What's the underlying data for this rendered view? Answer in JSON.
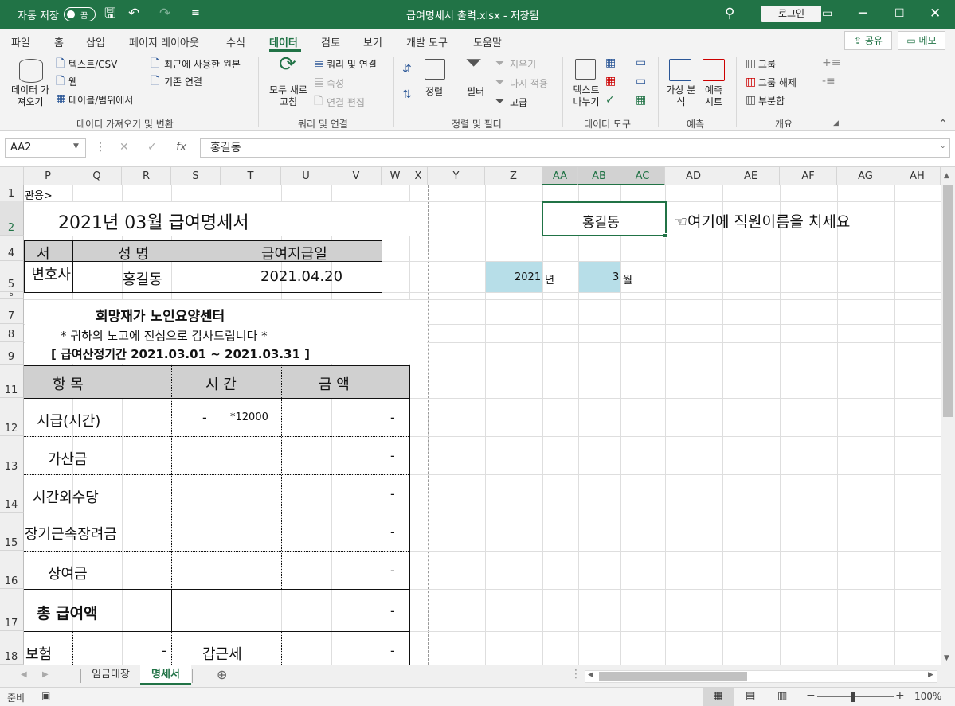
{
  "title_bar": {
    "autosave_label": "자동 저장",
    "autosave_state": "끔",
    "doc_title": "급여명세서 출력.xlsx  -  저장됨",
    "login_label": "로그인"
  },
  "ribbon_tabs": [
    "파일",
    "홈",
    "삽입",
    "페이지 레이아웃",
    "수식",
    "데이터",
    "검토",
    "보기",
    "개발 도구",
    "도움말"
  ],
  "active_tab": "데이터",
  "share_label": "공유",
  "memo_label": "메모",
  "ribbon": {
    "get_data": "데이터 가져오기",
    "text_csv": "텍스트/CSV",
    "web": "웹",
    "table_range": "테이블/범위에서",
    "recent_sources": "최근에 사용한 원본",
    "existing_conn": "기존 연결",
    "group_get": "데이터 가져오기 및 변환",
    "refresh_all": "모두 새로 고침",
    "queries_conn": "쿼리 및 연결",
    "properties": "속성",
    "edit_links": "연결 편집",
    "group_queries": "쿼리 및 연결",
    "sort": "정렬",
    "filter": "필터",
    "clear": "지우기",
    "reapply": "다시 적용",
    "advanced": "고급",
    "group_sort": "정렬 및 필터",
    "text_to_columns": "텍스트 나누기",
    "group_tools": "데이터 도구",
    "what_if": "가상 분석",
    "forecast_sheet": "예측 시트",
    "group_forecast": "예측",
    "group_btn": "그룹",
    "ungroup_btn": "그룹 해제",
    "subtotal": "부분합",
    "group_outline": "개요"
  },
  "formula_bar": {
    "name_box": "AA2",
    "formula": "홍길동"
  },
  "columns": [
    "P",
    "Q",
    "R",
    "S",
    "T",
    "U",
    "V",
    "W",
    "X",
    "Y",
    "Z",
    "AA",
    "AB",
    "AC",
    "AD",
    "AE",
    "AF",
    "AG",
    "AH"
  ],
  "selected_columns": [
    "AA",
    "AB",
    "AC"
  ],
  "rows": [
    "1",
    "2",
    "4",
    "5",
    "6",
    "7",
    "8",
    "9",
    "11",
    "12",
    "13",
    "14",
    "15",
    "16",
    "17",
    "18"
  ],
  "sheet": {
    "r1_text": "관용>",
    "title": "2021년 03월 급여명세서",
    "hdr_dept": "서",
    "hdr_name": "성      명",
    "hdr_paydate": "급여지급일",
    "val_dept": "변호사",
    "val_name": "홍길동",
    "val_paydate": "2021.04.20",
    "org_name": "희망재가 노인요양센터",
    "thanks": "* 귀하의 노고에 진심으로 감사드립니다 *",
    "period": "[ 급여산정기간 2021.03.01 ~ 2021.03.31 ]",
    "col_item": "항  목",
    "col_time": "시  간",
    "col_amount": "금      액",
    "items": [
      "시급(시간)",
      "가산금",
      "시간외수당",
      "장기근속장려금",
      "상여금"
    ],
    "hourly_dash": "-",
    "hourly_rate": "*12000",
    "dash": "-",
    "total_label": "총 급여액",
    "insurance": "보험",
    "income_tax": "갑근세",
    "employee_name": "홍길동",
    "hint": "☜여기에 직원이름을 치세요",
    "year_val": "2021",
    "year_unit": "년",
    "month_val": "3",
    "month_unit": "월"
  },
  "sheet_tabs": [
    "임금대장",
    "명세서"
  ],
  "active_sheet": "명세서",
  "status": {
    "ready": "준비",
    "zoom": "100%"
  },
  "accent": "#217346"
}
